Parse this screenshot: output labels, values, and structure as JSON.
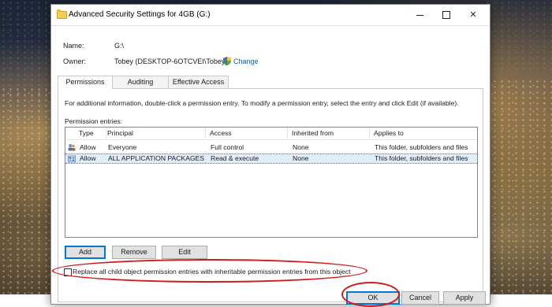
{
  "window": {
    "title": "Advanced Security Settings for 4GB (G:)",
    "close_glyph": "✕"
  },
  "fields": {
    "name_label": "Name:",
    "name_value": "G:\\",
    "owner_label": "Owner:",
    "owner_value": "Tobey (DESKTOP-6OTCVEI\\Tobey)",
    "change_link": "Change"
  },
  "tabs": [
    {
      "label": "Permissions",
      "active": true
    },
    {
      "label": "Auditing",
      "active": false
    },
    {
      "label": "Effective Access",
      "active": false
    }
  ],
  "permissions": {
    "info_text": "For additional information, double-click a permission entry. To modify a permission entry, select the entry and click Edit (if available).",
    "entries_label": "Permission entries:",
    "columns": [
      "Type",
      "Principal",
      "Access",
      "Inherited from",
      "Applies to"
    ],
    "rows": [
      {
        "type": "Allow",
        "principal": "Everyone",
        "access": "Full control",
        "inherited_from": "None",
        "applies_to": "This folder, subfolders and files",
        "icon": "users-icon"
      },
      {
        "type": "Allow",
        "principal": "ALL APPLICATION PACKAGES",
        "access": "Read & execute",
        "inherited_from": "None",
        "applies_to": "This folder, subfolders and files",
        "icon": "packages-icon"
      }
    ],
    "add_label": "Add",
    "remove_label": "Remove",
    "edit_label": "Edit"
  },
  "replace_checkbox": {
    "label": "Replace all child object permission entries with inheritable permission entries from this object",
    "checked": false
  },
  "footer": {
    "ok_label": "OK",
    "cancel_label": "Cancel",
    "apply_label": "Apply"
  },
  "colors": {
    "annotation": "#d21a1a",
    "link": "#0b5fc0",
    "selection": "#e3eefc"
  }
}
